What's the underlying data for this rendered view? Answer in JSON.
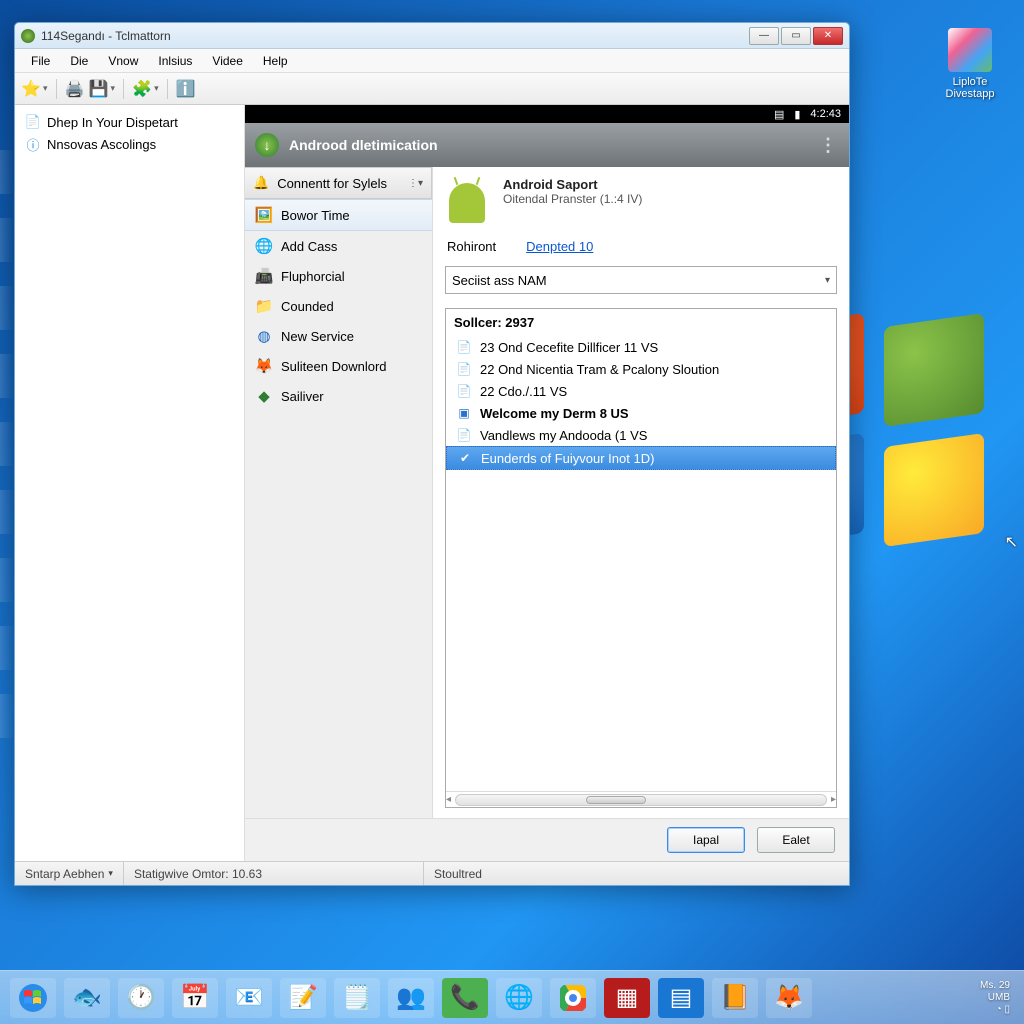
{
  "desktop": {
    "icon1_label": "LiploTe",
    "icon2_label": "Divestapp"
  },
  "window": {
    "title": "114Segandı - Tclmattorn",
    "menus": [
      "File",
      "Die",
      "Vnow",
      "Inlsius",
      "Videe",
      "Help"
    ],
    "tree": [
      {
        "icon": "📄",
        "label": "Dhep In Your Dispetart"
      },
      {
        "icon": "ℹ️",
        "label": "Nnsovas Ascolings"
      }
    ],
    "phonebar": {
      "time": "4:2:43"
    },
    "sectionhead": "Androod dletimication",
    "nav_header": "Connentt for Sylels",
    "nav_items": [
      {
        "icon": "🖼️",
        "label": "Bowor Time",
        "sel": true
      },
      {
        "icon": "🌐",
        "label": "Add Cass"
      },
      {
        "icon": "📠",
        "label": "Fluphorcial"
      },
      {
        "icon": "📁",
        "label": "Counded"
      },
      {
        "icon": "🔵",
        "label": "New Service"
      },
      {
        "icon": "🦊",
        "label": "Suliteen Downlord"
      },
      {
        "icon": "◆",
        "label": "Sailiver"
      }
    ],
    "device": {
      "title": "Android Saport",
      "subtitle": "Oitendal Pranster (1.:4 IV)",
      "link1_label": "Rohiront",
      "link2": "Denpted 10"
    },
    "combo": "Seciist ass NAM",
    "list_header": "Sollcer: 2937",
    "list": [
      {
        "icon": "📄",
        "text": "23 Ond Cecefite Dillficer 11 VS"
      },
      {
        "icon": "📄",
        "text": "22 Ond Nicentia Tram & Pcalony Sloution"
      },
      {
        "icon": "📄",
        "text": "22 Cdo./.11 VS"
      },
      {
        "icon": "▣",
        "text": "Welcome my Derm 8 US"
      },
      {
        "icon": "📄",
        "text": "Vandlews my Andooda (1 VS"
      },
      {
        "icon": "✔",
        "text": "Eunderds of Fuiyvour Inot 1D)",
        "sel": true
      }
    ],
    "buttons": {
      "primary": "Iapal",
      "secondary": "Ealet"
    },
    "status": {
      "left": "Sntarp Aebhen",
      "mid": "Statigwive Omtor: 10.63",
      "right": "Stoultred"
    }
  },
  "tray": {
    "line1": "Ms. 29",
    "line2": "UMB"
  }
}
